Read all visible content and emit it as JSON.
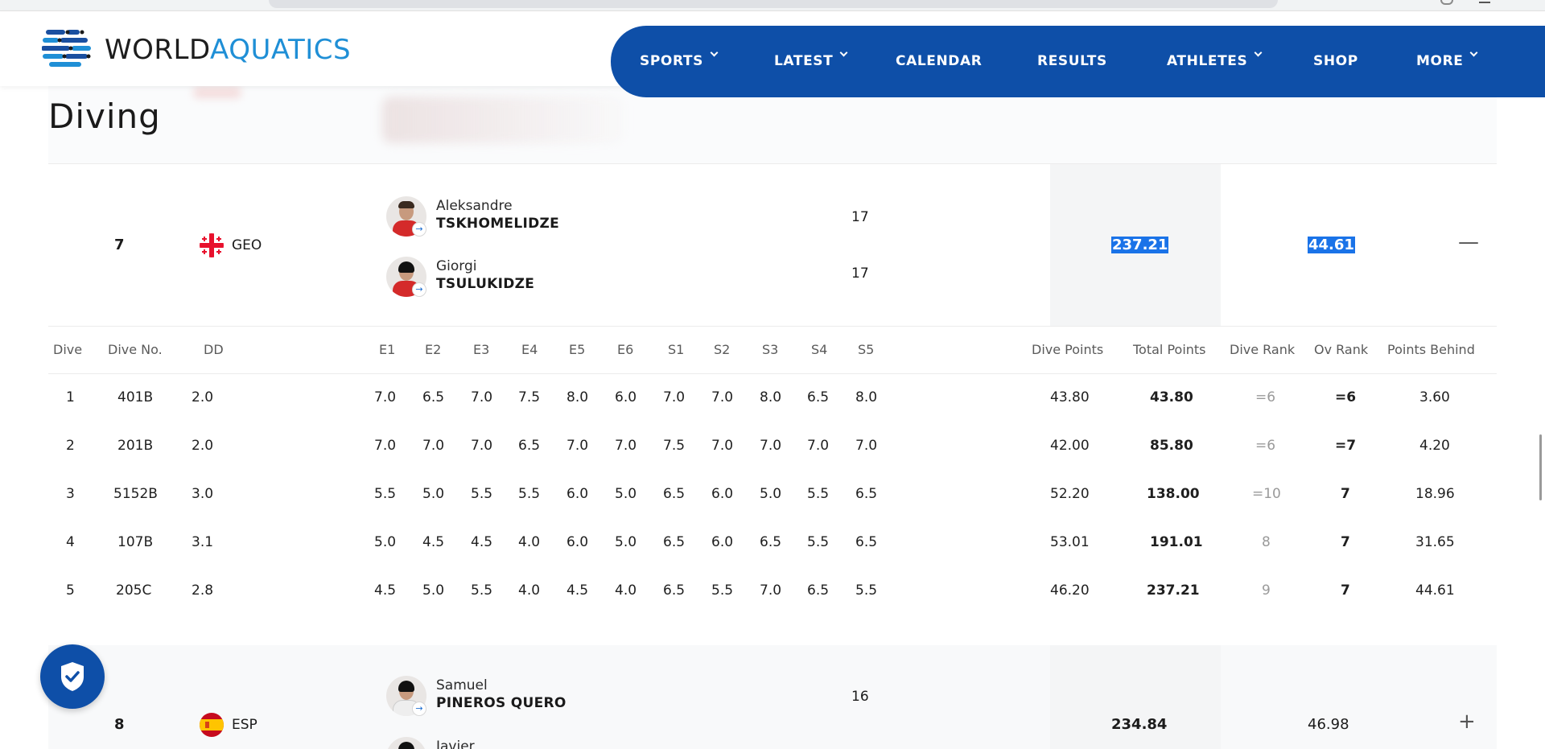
{
  "brand": {
    "word1": "WORLD",
    "word2": "AQUATICS"
  },
  "nav": [
    {
      "label": "SPORTS",
      "has_dropdown": true
    },
    {
      "label": "LATEST",
      "has_dropdown": true
    },
    {
      "label": "CALENDAR",
      "has_dropdown": false
    },
    {
      "label": "RESULTS",
      "has_dropdown": false
    },
    {
      "label": "ATHLETES",
      "has_dropdown": true
    },
    {
      "label": "SHOP",
      "has_dropdown": false
    },
    {
      "label": "MORE",
      "has_dropdown": true
    }
  ],
  "page_title": "Diving",
  "teams": [
    {
      "rank": "7",
      "country": "GEO",
      "athletes": [
        {
          "first": "Aleksandre",
          "last": "TSKHOMELIDZE",
          "age": "17"
        },
        {
          "first": "Giorgi",
          "last": "TSULUKIDZE",
          "age": "17"
        }
      ],
      "total": "237.21",
      "points_behind": "44.61",
      "toggle": "—"
    },
    {
      "rank": "8",
      "country": "ESP",
      "athletes": [
        {
          "first": "Samuel",
          "last": "PINEROS QUERO",
          "age": "16"
        },
        {
          "first": "Javier",
          "last": ""
        }
      ],
      "total": "234.84",
      "points_behind": "46.98",
      "toggle": "+"
    }
  ],
  "dive_table": {
    "headers": [
      "Dive",
      "Dive No.",
      "DD",
      "E1",
      "E2",
      "E3",
      "E4",
      "E5",
      "E6",
      "S1",
      "S2",
      "S3",
      "S4",
      "S5",
      "Dive Points",
      "Total Points",
      "Dive Rank",
      "Ov Rank",
      "Points Behind"
    ],
    "rows": [
      [
        "1",
        "401B",
        "2.0",
        "7.0",
        "6.5",
        "7.0",
        "7.5",
        "8.0",
        "6.0",
        "7.0",
        "7.0",
        "8.0",
        "6.5",
        "8.0",
        "43.80",
        "43.80",
        "=6",
        "=6",
        "3.60"
      ],
      [
        "2",
        "201B",
        "2.0",
        "7.0",
        "7.0",
        "7.0",
        "6.5",
        "7.0",
        "7.0",
        "7.5",
        "7.0",
        "7.0",
        "7.0",
        "7.0",
        "42.00",
        "85.80",
        "=6",
        "=7",
        "4.20"
      ],
      [
        "3",
        "5152B",
        "3.0",
        "5.5",
        "5.0",
        "5.5",
        "5.5",
        "6.0",
        "5.0",
        "6.5",
        "6.0",
        "5.0",
        "5.5",
        "6.5",
        "52.20",
        "138.00",
        "=10",
        "7",
        "18.96"
      ],
      [
        "4",
        "107B",
        "3.1",
        "5.0",
        "4.5",
        "4.5",
        "4.0",
        "6.0",
        "5.0",
        "6.5",
        "6.0",
        "6.5",
        "5.5",
        "6.5",
        "53.01",
        "191.01",
        "8",
        "7",
        "31.65"
      ],
      [
        "5",
        "205C",
        "2.8",
        "4.5",
        "5.0",
        "5.5",
        "4.0",
        "4.5",
        "4.0",
        "6.5",
        "5.5",
        "7.0",
        "6.5",
        "5.5",
        "46.20",
        "237.21",
        "9",
        "7",
        "44.61"
      ]
    ]
  },
  "colors": {
    "brand_blue": "#0e4fa8",
    "accent_blue": "#1f8fd6",
    "selection": "#1a73e8"
  }
}
